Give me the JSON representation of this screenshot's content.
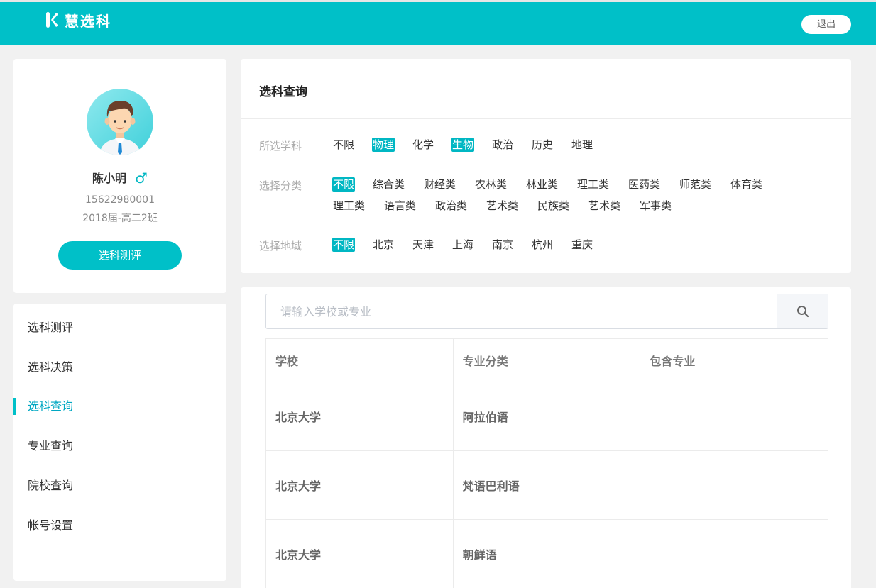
{
  "header": {
    "brand": "慧选科",
    "logout_label": "退出"
  },
  "profile": {
    "name": "陈小明",
    "gender_icon": "male-icon",
    "phone": "15622980001",
    "class": "2018届-高二2班",
    "eval_button": "选科测评"
  },
  "sidebar": {
    "items": [
      {
        "label": "选科测评",
        "active": false
      },
      {
        "label": "选科决策",
        "active": false
      },
      {
        "label": "选科查询",
        "active": true
      },
      {
        "label": "专业查询",
        "active": false
      },
      {
        "label": "院校查询",
        "active": false
      },
      {
        "label": "帐号设置",
        "active": false
      }
    ]
  },
  "query": {
    "title": "选科查询",
    "subjects": {
      "label": "所选学科",
      "options": [
        "不限",
        "物理",
        "化学",
        "生物",
        "政治",
        "历史",
        "地理"
      ],
      "selected": [
        "物理",
        "生物"
      ]
    },
    "categories": {
      "label": "选择分类",
      "options": [
        "不限",
        "综合类",
        "财经类",
        "农林类",
        "林业类",
        "理工类",
        "医药类",
        "师范类",
        "体育类",
        "理工类",
        "语言类",
        "政治类",
        "艺术类",
        "民族类",
        "艺术类",
        "军事类"
      ],
      "selected": [
        "不限"
      ]
    },
    "regions": {
      "label": "选择地域",
      "options": [
        "不限",
        "北京",
        "天津",
        "上海",
        "南京",
        "杭州",
        "重庆"
      ],
      "selected": [
        "不限"
      ]
    }
  },
  "results": {
    "search_placeholder": "请输入学校或专业",
    "search_icon": "search-icon",
    "columns": [
      "学校",
      "专业分类",
      "包含专业"
    ],
    "rows": [
      [
        "北京大学",
        "阿拉伯语",
        ""
      ],
      [
        "北京大学",
        "梵语巴利语",
        ""
      ],
      [
        "北京大学",
        "朝鲜语",
        ""
      ]
    ]
  },
  "colors": {
    "accent": "#00c0c8",
    "background": "#f1f1f1"
  }
}
